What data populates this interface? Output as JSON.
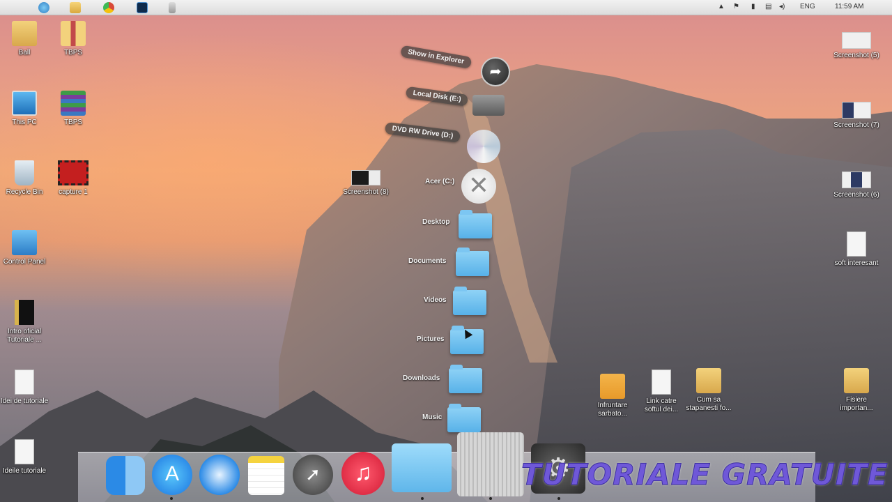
{
  "taskbar": {
    "language": "ENG",
    "clock": "11:59 AM"
  },
  "desktop_left": [
    {
      "label": "Ball",
      "icon": "user-folder-icon"
    },
    {
      "label": "TBPS",
      "icon": "winrar-archive-icon"
    },
    {
      "label": "This PC",
      "icon": "computer-icon"
    },
    {
      "label": "TBPS",
      "icon": "winrar-archive-icon"
    },
    {
      "label": "Recycle Bin",
      "icon": "recycle-bin-icon"
    },
    {
      "label": "capture 1",
      "icon": "video-file-icon"
    },
    {
      "label": "Control Panel",
      "icon": "control-panel-icon"
    },
    {
      "label": "Intro oficial Tutoriale ...",
      "icon": "folder-icon"
    },
    {
      "label": "Idei de tutoriale",
      "icon": "document-icon"
    },
    {
      "label": "Ideile tutoriale",
      "icon": "document-icon"
    }
  ],
  "desktop_center": {
    "label": "Screenshot (8)"
  },
  "desktop_right": [
    {
      "label": "Screenshot (5)"
    },
    {
      "label": "Screenshot (7)"
    },
    {
      "label": "Screenshot (6)"
    },
    {
      "label": "soft interesant"
    },
    {
      "label": "Fisiere importan..."
    }
  ],
  "desktop_bottom": [
    {
      "label": "Infruntare sarbato..."
    },
    {
      "label": "Link catre softul dei..."
    },
    {
      "label": "Cum sa stapanesti fo..."
    }
  ],
  "stack": {
    "show_in_explorer": "Show in Explorer",
    "items": [
      {
        "label": "Local Disk (E:)"
      },
      {
        "label": "DVD RW Drive (D:)"
      },
      {
        "label": "Acer (C:)"
      },
      {
        "label": "Desktop"
      },
      {
        "label": "Documents"
      },
      {
        "label": "Videos"
      },
      {
        "label": "Pictures"
      },
      {
        "label": "Downloads"
      },
      {
        "label": "Music"
      }
    ]
  },
  "dock": {
    "items": [
      "Finder",
      "App Store",
      "Safari",
      "Notes",
      "Launchpad",
      "iTunes",
      "Applications",
      "Mac Pro",
      "System Preferences"
    ]
  },
  "watermark": "TUTORIALE GRATUITE",
  "colors": {
    "folder": "#57b1e8",
    "watermark": "#6f58d8"
  }
}
